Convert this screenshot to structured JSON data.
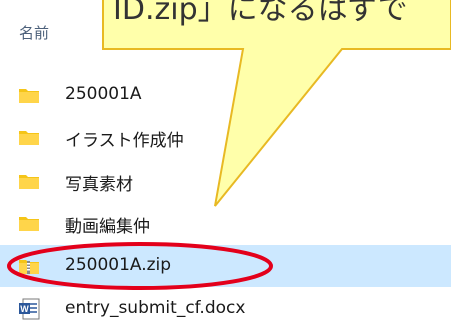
{
  "file_list": {
    "column_name_header": "名前",
    "items": [
      {
        "name": "250001A",
        "type": "folder",
        "icon": "folder-icon"
      },
      {
        "name": "イラスト作成仲",
        "type": "folder",
        "icon": "folder-icon"
      },
      {
        "name": "写真素材",
        "type": "folder",
        "icon": "folder-icon"
      },
      {
        "name": "動画編集仲",
        "type": "folder",
        "icon": "folder-icon"
      },
      {
        "name": "250001A.zip",
        "type": "zip",
        "icon": "zip-folder-icon",
        "selected": true
      },
      {
        "name": "entry_submit_cf.docx",
        "type": "docx",
        "icon": "word-document-icon"
      }
    ]
  },
  "callout": {
    "text": "ID.zip」になるはずで"
  },
  "colors": {
    "selection": "#cce8ff",
    "callout_fill": "#ffffaa",
    "callout_stroke": "#e8b923",
    "highlight_ellipse": "#e3001b",
    "folder": "#f5c518",
    "word_blue": "#2b579a"
  }
}
